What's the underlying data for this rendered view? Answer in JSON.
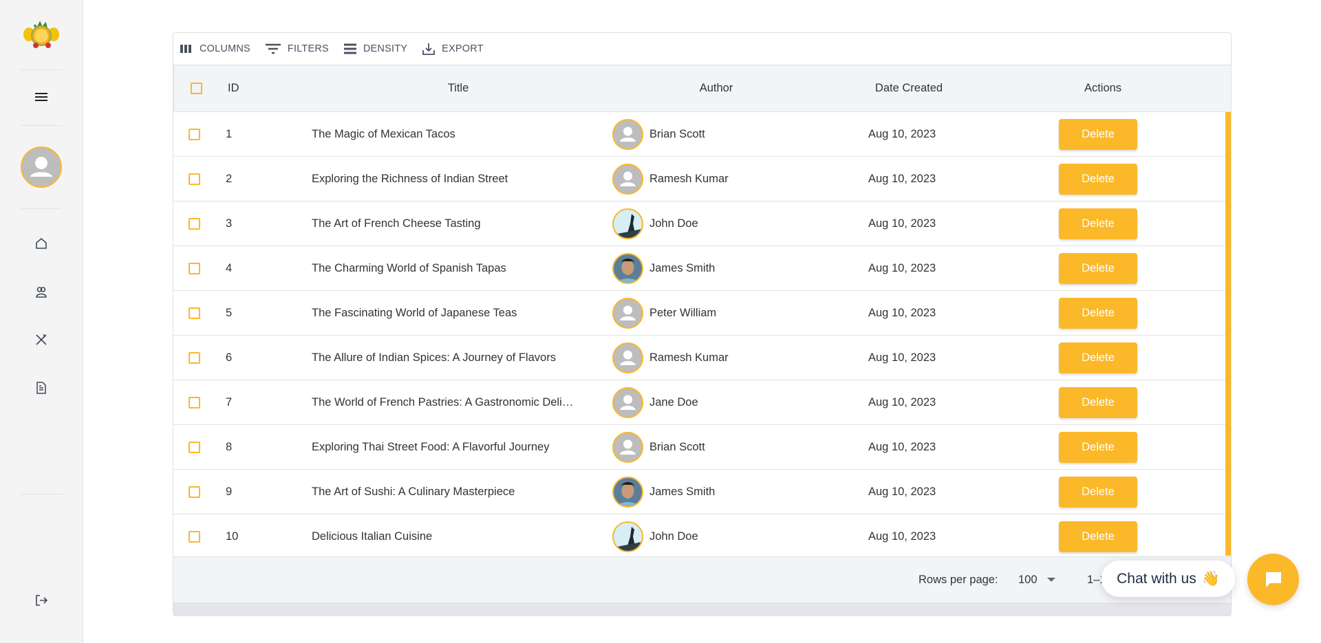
{
  "colors": {
    "accent": "#fbb829",
    "sidebar_bg": "#f4f4f5",
    "header_bg": "#f2f4f7"
  },
  "sidebar": {
    "logo": "fruit-logo",
    "items": [
      {
        "icon": "home-icon",
        "label": "home"
      },
      {
        "icon": "users-icon",
        "label": "users"
      },
      {
        "icon": "utensils-icon",
        "label": "recipes"
      },
      {
        "icon": "document-icon",
        "label": "posts"
      }
    ]
  },
  "toolbar": {
    "columns": "COLUMNS",
    "filters": "FILTERS",
    "density": "DENSITY",
    "export": "EXPORT"
  },
  "table": {
    "headers": {
      "id": "ID",
      "title": "Title",
      "author": "Author",
      "date": "Date Created",
      "actions": "Actions"
    },
    "rows": [
      {
        "id": "1",
        "title": "The Magic of Mexican Tacos",
        "author": "Brian Scott",
        "avatar": "default",
        "date": "Aug 10, 2023",
        "action": "Delete"
      },
      {
        "id": "2",
        "title": "Exploring the Richness of Indian Street",
        "author": "Ramesh Kumar",
        "avatar": "default",
        "date": "Aug 10, 2023",
        "action": "Delete"
      },
      {
        "id": "3",
        "title": "The Art of French Cheese Tasting",
        "author": "John Doe",
        "avatar": "photo-landscape",
        "date": "Aug 10, 2023",
        "action": "Delete"
      },
      {
        "id": "4",
        "title": "The Charming World of Spanish Tapas",
        "author": "James Smith",
        "avatar": "photo-man",
        "date": "Aug 10, 2023",
        "action": "Delete"
      },
      {
        "id": "5",
        "title": "The Fascinating World of Japanese Teas",
        "author": "Peter William",
        "avatar": "default",
        "date": "Aug 10, 2023",
        "action": "Delete"
      },
      {
        "id": "6",
        "title": "The Allure of Indian Spices: A Journey of Flavors",
        "author": "Ramesh Kumar",
        "avatar": "default",
        "date": "Aug 10, 2023",
        "action": "Delete"
      },
      {
        "id": "7",
        "title": "The World of French Pastries: A Gastronomic Deli…",
        "author": "Jane Doe",
        "avatar": "default",
        "date": "Aug 10, 2023",
        "action": "Delete"
      },
      {
        "id": "8",
        "title": "Exploring Thai Street Food: A Flavorful Journey",
        "author": "Brian Scott",
        "avatar": "default",
        "date": "Aug 10, 2023",
        "action": "Delete"
      },
      {
        "id": "9",
        "title": "The Art of Sushi: A Culinary Masterpiece",
        "author": "James Smith",
        "avatar": "photo-man",
        "date": "Aug 10, 2023",
        "action": "Delete"
      },
      {
        "id": "10",
        "title": "Delicious Italian Cuisine",
        "author": "John Doe",
        "avatar": "photo-landscape",
        "date": "Aug 10, 2023",
        "action": "Delete"
      }
    ]
  },
  "footer": {
    "rows_per_page_label": "Rows per page:",
    "rows_per_page": "100",
    "range": "1–10 of 10"
  },
  "chat": {
    "label": "Chat with us",
    "emoji": "👋"
  }
}
